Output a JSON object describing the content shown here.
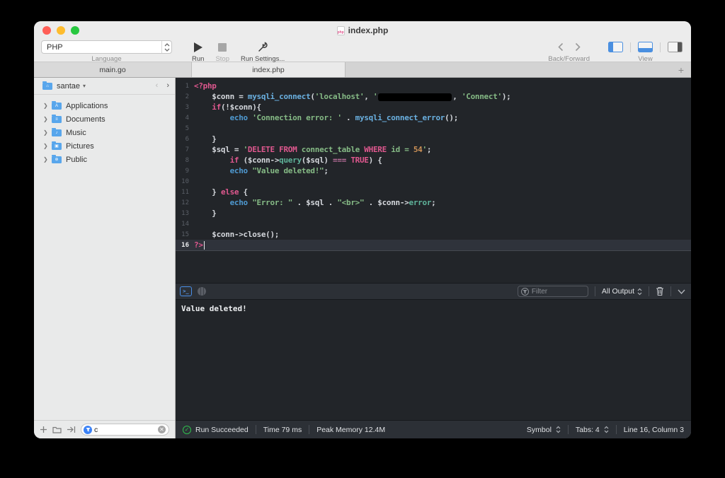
{
  "window": {
    "title": "index.php"
  },
  "toolbar": {
    "language_value": "PHP",
    "language_caption": "Language",
    "run_label": "Run",
    "stop_label": "Stop",
    "run_settings_label": "Run Settings...",
    "back_forward_caption": "Back/Forward",
    "view_caption": "View"
  },
  "tabs": {
    "items": [
      {
        "label": "main.go"
      },
      {
        "label": "index.php"
      }
    ],
    "add_label": "+"
  },
  "sidebar": {
    "root_label": "santae",
    "items": [
      {
        "label": "Applications",
        "glyph": "A"
      },
      {
        "label": "Documents",
        "glyph": "≡"
      },
      {
        "label": "Music",
        "glyph": "♪"
      },
      {
        "label": "Pictures",
        "glyph": "▣"
      },
      {
        "label": "Public",
        "glyph": "⊕"
      }
    ],
    "filter_value": "c"
  },
  "editor": {
    "current_line": 16,
    "lines": [
      [
        {
          "c": "php",
          "t": "<?php"
        }
      ],
      [
        {
          "c": "pl",
          "t": "    $conn = "
        },
        {
          "c": "fn",
          "t": "mysqli_connect"
        },
        {
          "c": "pl",
          "t": "("
        },
        {
          "c": "str",
          "t": "'localhost'"
        },
        {
          "c": "pl",
          "t": ", "
        },
        {
          "c": "str",
          "t": "'"
        },
        {
          "c": "red",
          "t": ""
        },
        {
          "c": "pl",
          "t": ", "
        },
        {
          "c": "str",
          "t": "'Connect'"
        },
        {
          "c": "pl",
          "t": ");"
        }
      ],
      [
        {
          "c": "pl",
          "t": "    "
        },
        {
          "c": "kw",
          "t": "if"
        },
        {
          "c": "pl",
          "t": "(!$conn){"
        }
      ],
      [
        {
          "c": "pl",
          "t": "        "
        },
        {
          "c": "ec",
          "t": "echo"
        },
        {
          "c": "pl",
          "t": " "
        },
        {
          "c": "str",
          "t": "'Connection error: '"
        },
        {
          "c": "pl",
          "t": " . "
        },
        {
          "c": "fn",
          "t": "mysqli_connect_error"
        },
        {
          "c": "pl",
          "t": "();"
        }
      ],
      [],
      [
        {
          "c": "pl",
          "t": "    }"
        }
      ],
      [
        {
          "c": "pl",
          "t": "    $sql = "
        },
        {
          "c": "str",
          "t": "'"
        },
        {
          "c": "sql",
          "t": "DELETE FROM"
        },
        {
          "c": "str",
          "t": " connect_table "
        },
        {
          "c": "sql",
          "t": "WHERE"
        },
        {
          "c": "str",
          "t": " id = "
        },
        {
          "c": "num",
          "t": "54"
        },
        {
          "c": "str",
          "t": "'"
        },
        {
          "c": "pl",
          "t": ";"
        }
      ],
      [
        {
          "c": "pl",
          "t": "        "
        },
        {
          "c": "kw",
          "t": "if"
        },
        {
          "c": "pl",
          "t": " ($conn->"
        },
        {
          "c": "meth",
          "t": "query"
        },
        {
          "c": "pl",
          "t": "($sql) "
        },
        {
          "c": "op3",
          "t": "==="
        },
        {
          "c": "pl",
          "t": " "
        },
        {
          "c": "kw",
          "t": "TRUE"
        },
        {
          "c": "pl",
          "t": ") {"
        }
      ],
      [
        {
          "c": "pl",
          "t": "        "
        },
        {
          "c": "ec",
          "t": "echo"
        },
        {
          "c": "pl",
          "t": " "
        },
        {
          "c": "str",
          "t": "\"Value deleted!\""
        },
        {
          "c": "pl",
          "t": ";"
        }
      ],
      [],
      [
        {
          "c": "pl",
          "t": "    } "
        },
        {
          "c": "kw",
          "t": "else"
        },
        {
          "c": "pl",
          "t": " {"
        }
      ],
      [
        {
          "c": "pl",
          "t": "        "
        },
        {
          "c": "ec",
          "t": "echo"
        },
        {
          "c": "pl",
          "t": " "
        },
        {
          "c": "str",
          "t": "\"Error: \""
        },
        {
          "c": "pl",
          "t": " . $sql . "
        },
        {
          "c": "str",
          "t": "\"<br>\""
        },
        {
          "c": "pl",
          "t": " . $conn->"
        },
        {
          "c": "meth",
          "t": "error"
        },
        {
          "c": "pl",
          "t": ";"
        }
      ],
      [
        {
          "c": "pl",
          "t": "    }"
        }
      ],
      [],
      [
        {
          "c": "pl",
          "t": "    $conn->close();"
        }
      ],
      [
        {
          "c": "php",
          "t": "?>"
        }
      ]
    ]
  },
  "console": {
    "terminal_icon_glyph": ">_",
    "filter_placeholder": "Filter",
    "output_select_value": "All Output",
    "output_text": "Value deleted!"
  },
  "statusbar": {
    "run_status": "Run Succeeded",
    "time": "Time 79 ms",
    "memory": "Peak Memory 12.4M",
    "symbol": "Symbol",
    "tabs_count": "Tabs: 4",
    "caret_position": "Line 16, Column 3"
  },
  "colors": {
    "accent_blue": "#4a8fe0",
    "keyword_pink": "#e0588f",
    "string_green": "#85ba85",
    "function_blue": "#6ab0e0",
    "number_orange": "#cc9157",
    "success_green": "#2fbf4d",
    "editor_bg": "#222529"
  }
}
